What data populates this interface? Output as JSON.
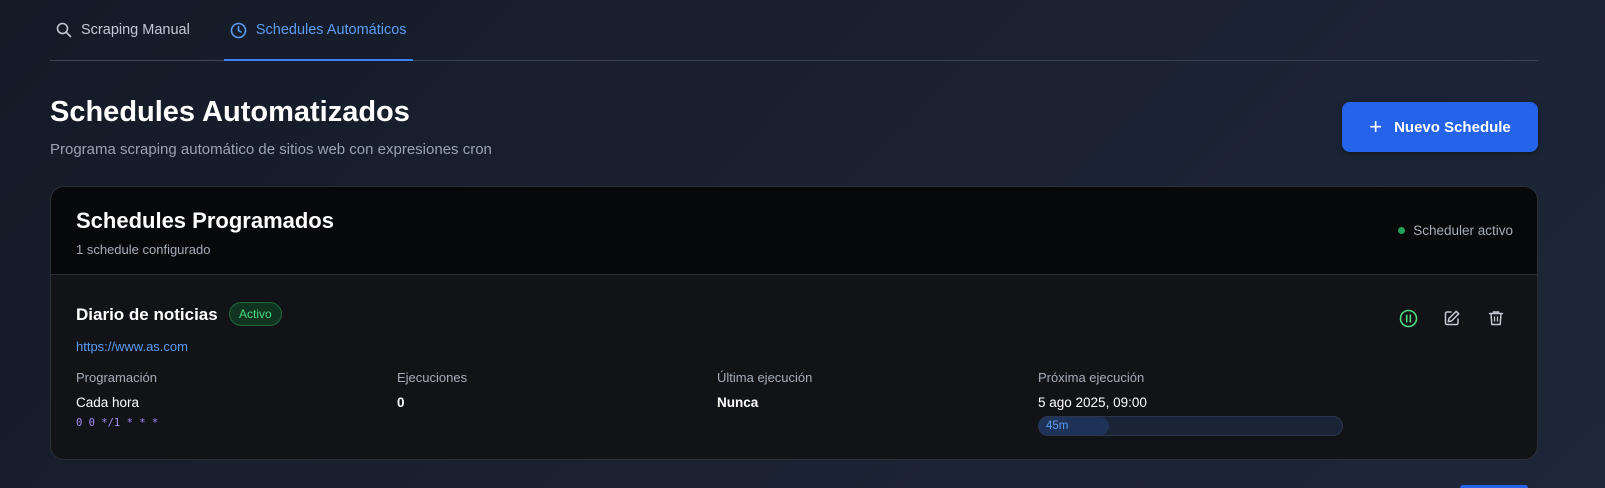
{
  "tabs": [
    {
      "label": "Scraping Manual",
      "icon": "search-icon",
      "active": false
    },
    {
      "label": "Schedules Automáticos",
      "icon": "clock-icon",
      "active": true
    }
  ],
  "page": {
    "title": "Schedules Automatizados",
    "subtitle": "Programa scraping automático de sitios web con expresiones cron",
    "new_button": "Nuevo Schedule"
  },
  "card": {
    "title": "Schedules Programados",
    "count": "1 schedule configurado",
    "status": "Scheduler activo"
  },
  "schedule": {
    "name": "Diario de noticias",
    "badge": "Activo",
    "url": "https://www.as.com",
    "programacion_label": "Programación",
    "programacion_value": "Cada hora",
    "cron": "0 0 */1 * * *",
    "ejecuciones_label": "Ejecuciones",
    "ejecuciones_value": "0",
    "ultima_label": "Última ejecución",
    "ultima_value": "Nunca",
    "proxima_label": "Próxima ejecución",
    "proxima_value": "5 ago 2025, 09:00",
    "countdown": "45m",
    "countdown_progress": 0.23
  },
  "colors": {
    "accent": "#2563eb",
    "active_tab": "#5b9cf5",
    "badge_green": "#4ade80",
    "cron_purple": "#a78bfa"
  }
}
